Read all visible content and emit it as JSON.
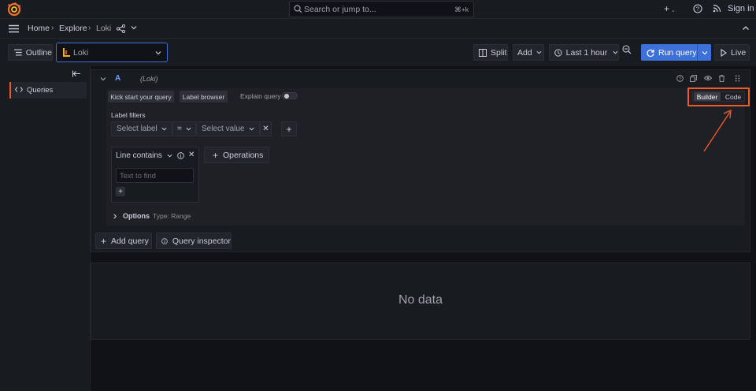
{
  "topbar": {
    "search_placeholder": "Search or jump to...",
    "search_shortcut": "⌘+k",
    "new_label": "+",
    "sign_in": "Sign in"
  },
  "breadcrumb": [
    "Home",
    "Explore",
    "Loki"
  ],
  "toolbar": {
    "outline": "Outline",
    "datasource": "Loki",
    "split": "Split",
    "add": "Add",
    "time_range": "Last 1 hour",
    "run_query": "Run query",
    "live": "Live"
  },
  "sidebar": {
    "items": [
      {
        "label": "Queries",
        "active": true
      }
    ]
  },
  "query": {
    "ref_id": "A",
    "datasource": "(Loki)",
    "kick_start": "Kick start your query",
    "label_browser": "Label browser",
    "explain_query": "Explain query",
    "explain_enabled": false,
    "mode_builder": "Builder",
    "mode_code": "Code",
    "active_mode": "Builder",
    "label_filters_title": "Label filters",
    "select_label_placeholder": "Select label",
    "operator": "=",
    "select_value_placeholder": "Select value",
    "operation_name": "Line contains",
    "text_to_find_placeholder": "Text to find",
    "operations_button": "Operations",
    "options_label": "Options",
    "options_type": "Type: Range"
  },
  "actions": {
    "add_query": "Add query",
    "query_inspector": "Query inspector"
  },
  "result": {
    "no_data": "No data"
  },
  "colors": {
    "accent": "#3d71d9",
    "highlight": "#f05a28",
    "background": "#111217",
    "panel": "#181b1f"
  }
}
